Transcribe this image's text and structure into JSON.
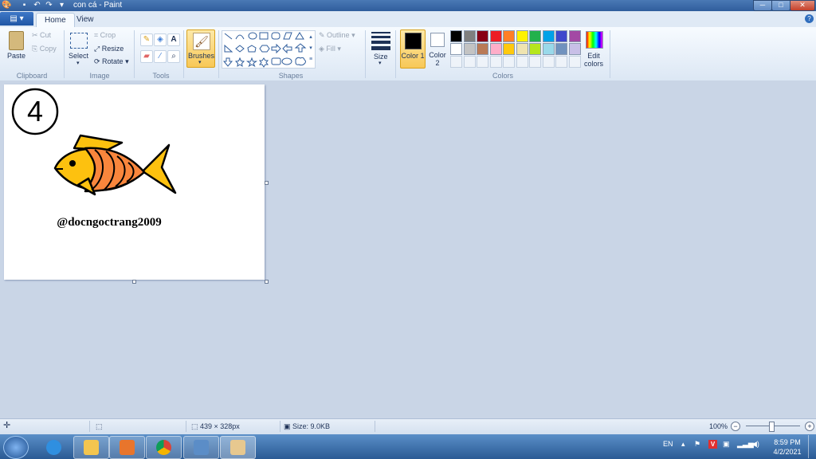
{
  "window": {
    "title": "con cá - Paint"
  },
  "tabs": {
    "home": "Home",
    "view": "View"
  },
  "clipboard": {
    "paste": "Paste",
    "cut": "Cut",
    "copy": "Copy",
    "label": "Clipboard"
  },
  "image": {
    "select": "Select",
    "crop": "Crop",
    "resize": "Resize",
    "rotate": "Rotate",
    "label": "Image"
  },
  "tools": {
    "label": "Tools"
  },
  "brushes": {
    "label": "Brushes"
  },
  "shapes": {
    "outline": "Outline",
    "fill": "Fill",
    "label": "Shapes"
  },
  "size": {
    "label": "Size"
  },
  "colors": {
    "color1": "Color 1",
    "color2": "Color 2",
    "edit": "Edit colors",
    "label": "Colors",
    "color1_value": "#000000",
    "color2_value": "#ffffff",
    "palette": [
      "#000000",
      "#7f7f7f",
      "#880015",
      "#ed1c24",
      "#ff7f27",
      "#fff200",
      "#22b14c",
      "#00a2e8",
      "#3f48cc",
      "#a349a4",
      "#ffffff",
      "#c3c3c3",
      "#b97a57",
      "#ffaec9",
      "#ffc90e",
      "#efe4b0",
      "#b5e61d",
      "#99d9ea",
      "#7092be",
      "#c8bfe7"
    ]
  },
  "drawing": {
    "number": "4",
    "caption": "@docngoctrang2009"
  },
  "status": {
    "dimensions": "439 × 328px",
    "size": "Size: 9.0KB",
    "zoom": "100%"
  },
  "tray": {
    "lang": "EN",
    "time": "8:59 PM",
    "date": "4/2/2021"
  }
}
